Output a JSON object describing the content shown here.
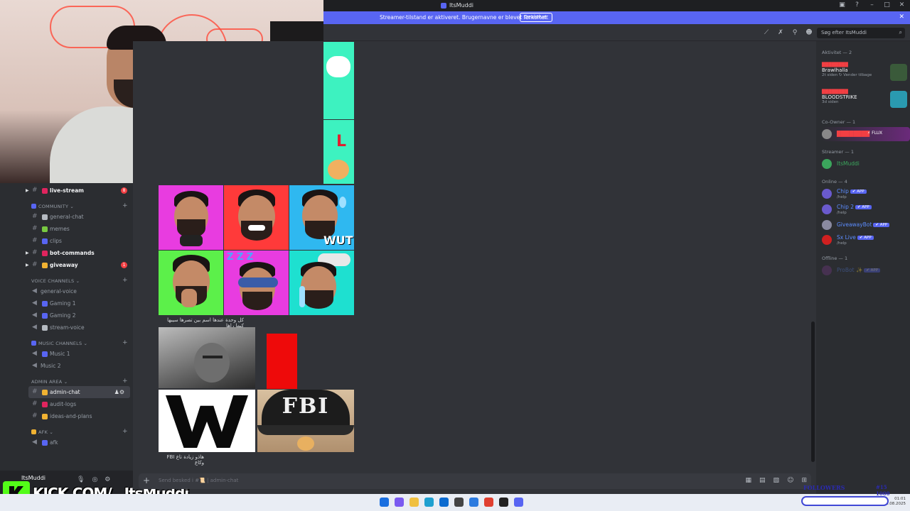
{
  "window": {
    "title": "ItsMuddi"
  },
  "banner": {
    "message": "Streamer-tilstand er aktiveret. Brugernavne er blevet forkortet.",
    "button": "Deaktiver"
  },
  "search": {
    "placeholder": "Søg efter ItsMuddi"
  },
  "sidebar": {
    "channels": [
      {
        "name": "live-stream",
        "unread": true,
        "badge": "8",
        "emoji_color": "#e0245e"
      },
      {
        "category": "COMMUNITY",
        "emoji_color": "#5865f2"
      },
      {
        "name": "general-chat",
        "unread": false,
        "emoji_color": "#b5bac1"
      },
      {
        "name": "memes",
        "unread": false,
        "emoji_color": "#78c841"
      },
      {
        "name": "clips",
        "unread": false,
        "emoji_color": "#5865f2"
      },
      {
        "name": "bot-commands",
        "unread": true,
        "emoji_color": "#e0245e"
      },
      {
        "name": "giveaway",
        "unread": true,
        "badge": "1",
        "emoji_color": "#f0b232"
      },
      {
        "category": "VOICE CHANNELS"
      },
      {
        "name": "general-voice",
        "voice": true
      },
      {
        "name": "Gaming 1",
        "voice": true,
        "emoji_color": "#5865f2"
      },
      {
        "name": "Gaming 2",
        "voice": true,
        "emoji_color": "#5865f2"
      },
      {
        "name": "stream-voice",
        "voice": true,
        "emoji_color": "#b5bac1"
      },
      {
        "category": "MUSIC CHANNELS",
        "emoji_color": "#5865f2"
      },
      {
        "name": "Music 1",
        "voice": true,
        "emoji_color": "#5865f2"
      },
      {
        "name": "Music 2",
        "voice": true
      },
      {
        "category": "ADMIN AREA"
      },
      {
        "name": "admin-chat",
        "selected": true,
        "emoji_color": "#f0b232"
      },
      {
        "name": "audit-logs",
        "unread": false,
        "emoji_color": "#e0245e"
      },
      {
        "name": "ideas-and-plans",
        "unread": false,
        "emoji_color": "#f0b232"
      },
      {
        "category": "AFK",
        "emoji_color": "#f0b232"
      },
      {
        "name": "afk",
        "voice": true,
        "emoji_color": "#5865f2"
      }
    ]
  },
  "user": {
    "name": "ItsMuddi"
  },
  "overlay": {
    "kick_text": "KICK.COM/",
    "kick_user": "ItsMuddi",
    "followers": "FOLLOWERS",
    "followers_count": "#15 1000"
  },
  "chat": {
    "caption1": "كل وحدة عندها اسم بين تصرها سيبها كيما راها",
    "caption2": "هاذو زيادة تاع FBI وكاع",
    "fbi_text": "FBI",
    "wut_text": "WUT",
    "zz_text": "Z Z Z",
    "composer_placeholder": "Send besked i #📜 | admin-chat"
  },
  "members": {
    "activity_header": "Aktivitet — 2",
    "activities": [
      {
        "user": "████████",
        "game": "Brawlhalla",
        "meta": "2t siden  ↻ Vender tilbage"
      },
      {
        "user": "████████",
        "game": "BLOODSTRIKE",
        "meta": "3d siden"
      }
    ],
    "coowner_header": "Co-Owner — 1",
    "coowner": {
      "name": "████████",
      "tag": "⚡ FLUX"
    },
    "streamer_header": "Streamer — 1",
    "streamer": {
      "name": "ItsMuddi"
    },
    "online_header": "Online — 4",
    "online": [
      {
        "name": "Chip",
        "tag": "✔ APP",
        "sub": "/help",
        "color": "#5c8dff"
      },
      {
        "name": "Chip 2",
        "tag": "✔ APP",
        "sub": "/help",
        "color": "#5c8dff"
      },
      {
        "name": "GiveawayBot",
        "tag": "✔ APP",
        "sub": "",
        "color": "#5c8dff"
      },
      {
        "name": "Sx Live",
        "tag": "✔ APP",
        "sub": "/help",
        "color": "#5c8dff"
      }
    ],
    "offline_header": "Offline — 1",
    "offline": {
      "name": "ProBot ✨",
      "tag": "✔ APP"
    }
  },
  "taskbar": {
    "time": "01:01",
    "date": "06.08.2025"
  }
}
